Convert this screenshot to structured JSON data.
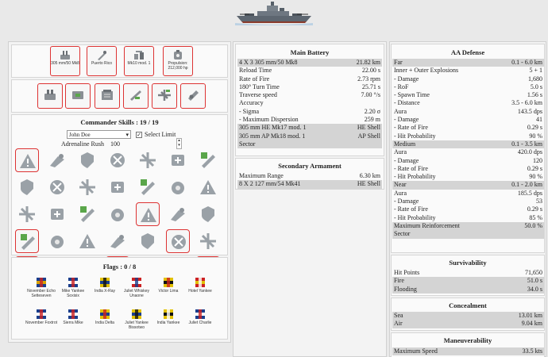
{
  "left": {
    "modules": [
      {
        "icon": "main-battery-icon",
        "label": "305 mm/50 Mk8"
      },
      {
        "icon": "hull-icon",
        "label": "Puerto Rico"
      },
      {
        "icon": "fire-control-icon",
        "label": "Mk10 mod. 1"
      },
      {
        "icon": "propulsion-icon",
        "label": "Propulsion: 212,000 hp"
      }
    ],
    "upgrades": [
      {
        "icon": "main-armaments-mod-icon"
      },
      {
        "icon": "damage-control-mod-icon"
      },
      {
        "icon": "aiming-systems-mod-icon"
      },
      {
        "icon": "aa-guns-mod-icon"
      },
      {
        "icon": "aircraft-mod-icon"
      },
      {
        "icon": "propulsion-mod-icon"
      }
    ],
    "commander": {
      "title": "Commander Skills : 19 / 19",
      "name": "John Doe",
      "select_limit": "Select Limit",
      "adrenaline_label": "Adrenaline Rush",
      "adrenaline_value": "100"
    },
    "flags": {
      "title": "Flags : 0 / 8",
      "items": [
        {
          "label": "November Echo Setteseven"
        },
        {
          "label": "Mike Yankee Soxisix"
        },
        {
          "label": "India X-Ray"
        },
        {
          "label": "Juliet Whiskey Unaone"
        },
        {
          "label": "Victor Lima"
        },
        {
          "label": "Hotel Yankee"
        },
        {
          "label": "November Foxtrot"
        },
        {
          "label": "Sierra Mike"
        },
        {
          "label": "India Delta"
        },
        {
          "label": "Juliet Yankee Bissotwo"
        },
        {
          "label": "India Yankee"
        },
        {
          "label": "Juliet Charlie"
        }
      ]
    }
  },
  "main_battery": {
    "title": "Main Battery",
    "rows": [
      {
        "k": "4 X 3 305 mm/50 Mk8",
        "v": "21.82 km",
        "g": true
      },
      {
        "k": "Reload Time",
        "v": "22.00 s",
        "g": false
      },
      {
        "k": "Rate of Fire",
        "v": "2.73 rpm",
        "g": false
      },
      {
        "k": "180° Turn Time",
        "v": "25.71 s",
        "g": false
      },
      {
        "k": "Traverse speed",
        "v": "7.00 °/s",
        "g": false
      },
      {
        "k": "Accuracy",
        "v": "",
        "g": false
      },
      {
        "k": "- Sigma",
        "v": "2.20 σ",
        "g": false
      },
      {
        "k": "- Maximum Dispersion",
        "v": "259 m",
        "g": false
      },
      {
        "k": "305 mm HE Mk17 mod. 1",
        "v": "HE Shell",
        "g": true
      },
      {
        "k": "305 mm AP Mk18 mod. 1",
        "v": "AP Shell",
        "g": true
      },
      {
        "k": "Sector",
        "v": "",
        "g": true
      }
    ]
  },
  "secondary": {
    "title": "Secondary Armament",
    "rows": [
      {
        "k": "Maximum Range",
        "v": "6.30 km",
        "g": false
      },
      {
        "k": "8 X 2 127 mm/54 Mk41",
        "v": "HE Shell",
        "g": true
      }
    ]
  },
  "aa": {
    "title": "AA Defense",
    "rows": [
      {
        "k": "Far",
        "v": "0.1 - 6.0 km",
        "g": true
      },
      {
        "k": "Inner + Outer Explosions",
        "v": "5 + 1",
        "g": false
      },
      {
        "k": "- Damage",
        "v": "1,680",
        "g": false
      },
      {
        "k": "- RoF",
        "v": "5.0 s",
        "g": false
      },
      {
        "k": "- Spawn Time",
        "v": "1.56 s",
        "g": false
      },
      {
        "k": "- Distance",
        "v": "3.5 - 6.0 km",
        "g": false
      },
      {
        "k": "Aura",
        "v": "143.5 dps",
        "g": false
      },
      {
        "k": "- Damage",
        "v": "41",
        "g": false
      },
      {
        "k": "- Rate of Fire",
        "v": "0.29 s",
        "g": false
      },
      {
        "k": "- Hit Probability",
        "v": "90 %",
        "g": false
      },
      {
        "k": "Medium",
        "v": "0.1 - 3.5 km",
        "g": true
      },
      {
        "k": "Aura",
        "v": "420.0 dps",
        "g": false
      },
      {
        "k": "- Damage",
        "v": "120",
        "g": false
      },
      {
        "k": "- Rate of Fire",
        "v": "0.29 s",
        "g": false
      },
      {
        "k": "- Hit Probability",
        "v": "90 %",
        "g": false
      },
      {
        "k": "Near",
        "v": "0.1 - 2.0 km",
        "g": true
      },
      {
        "k": "Aura",
        "v": "185.5 dps",
        "g": false
      },
      {
        "k": "- Damage",
        "v": "53",
        "g": false
      },
      {
        "k": "- Rate of Fire",
        "v": "0.29 s",
        "g": false
      },
      {
        "k": "- Hit Probability",
        "v": "85 %",
        "g": false
      },
      {
        "k": "Maximum Reinforcement",
        "v": "50.0 %",
        "g": true
      },
      {
        "k": "Sector",
        "v": "",
        "g": true
      }
    ]
  },
  "survivability": {
    "title": "Survivability",
    "rows": [
      {
        "k": "Hit Points",
        "v": "71,650",
        "g": false
      },
      {
        "k": "Fire",
        "v": "51.0 s",
        "g": true
      },
      {
        "k": "Flooding",
        "v": "34.0 s",
        "g": true
      }
    ]
  },
  "concealment": {
    "title": "Concealment",
    "rows": [
      {
        "k": "Sea",
        "v": "13.01 km",
        "g": true
      },
      {
        "k": "Air",
        "v": "9.04 km",
        "g": true
      }
    ]
  },
  "maneuverability": {
    "title": "Maneuverability",
    "rows": [
      {
        "k": "Maximum Speed",
        "v": "33.5 kts",
        "g": true
      }
    ]
  }
}
